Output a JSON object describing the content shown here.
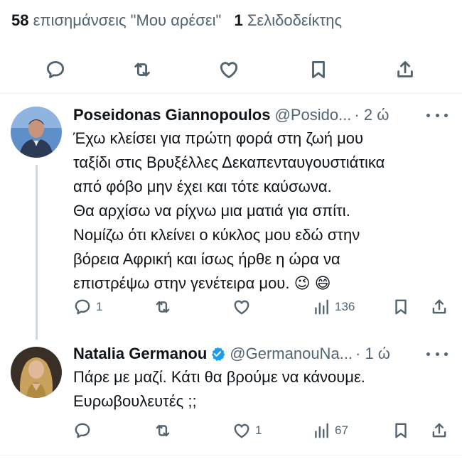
{
  "stats": {
    "likes_count": "58",
    "likes_label": "επισημάνσεις \"Μου αρέσει\"",
    "bookmarks_count": "1",
    "bookmarks_label": "Σελιδοδείκτης"
  },
  "actionbar": {
    "icons": [
      "reply-icon",
      "retweet-icon",
      "like-icon",
      "bookmark-icon",
      "share-icon"
    ]
  },
  "replies": [
    {
      "name": "Poseidonas Giannopoulos",
      "handle": "@Posido...",
      "time": "· 2 ώ",
      "verified": false,
      "lines": [
        "Έχω κλείσει για πρώτη φορά στη ζωή μου",
        "ταξίδι στις Βρυξέλλες Δεκαπενταυγουστιάτικα",
        "από φόβο μην έχει και τότε καύσωνα.",
        "Θα αρχίσω να ρίχνω μια ματιά για σπίτι.",
        "Νομίζω ότι κλείνει ο κύκλος μου εδώ στην",
        "βόρεια Αφρική και ίσως ήρθε η ώρα να",
        "επιστρέψω στην γενέτειρα μου. 😉 😄"
      ],
      "replies_count": "1",
      "retweets_count": "",
      "likes_count": "",
      "views_count": "136"
    },
    {
      "name": "Natalia Germanou",
      "handle": "@GermanouNa...",
      "time": "· 1 ώ",
      "verified": true,
      "lines": [
        "Πάρε με μαζί. Κάτι θα βρούμε να κάνουμε.",
        "Ευρωβουλευτές ;;"
      ],
      "replies_count": "",
      "retweets_count": "",
      "likes_count": "1",
      "views_count": "67"
    }
  ],
  "colors": {
    "text": "#0f1419",
    "secondary": "#536471",
    "divider": "#eff3f4",
    "verified": "#1d9bf0"
  }
}
